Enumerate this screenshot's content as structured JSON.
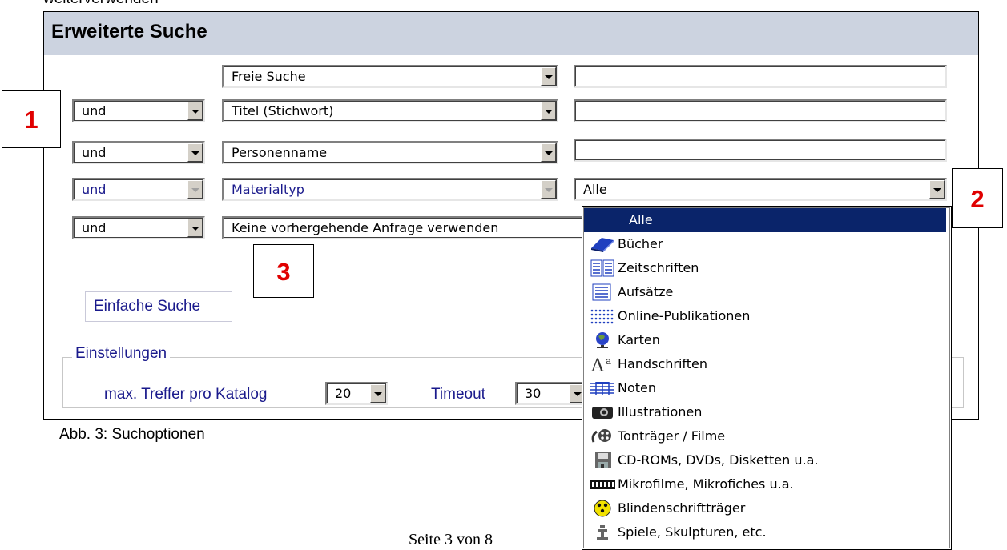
{
  "top_text": "weiterverwenden",
  "panel": {
    "title": "Erweiterte Suche",
    "rows": [
      {
        "operator": "",
        "field": "Freie Suche",
        "value": ""
      },
      {
        "operator": "und",
        "field": "Titel (Stichwort)",
        "value": ""
      },
      {
        "operator": "und",
        "field": "Personenname",
        "value": ""
      },
      {
        "operator": "und",
        "field": "Materialtyp",
        "value": "Alle"
      },
      {
        "operator": "und",
        "field": "Keine vorhergehende Anfrage verwenden",
        "value": ""
      }
    ],
    "simple_search_label": "Einfache Suche",
    "settings": {
      "legend": "Einstellungen",
      "max_hits_label": "max. Treffer pro Katalog",
      "max_hits_value": "20",
      "timeout_label": "Timeout",
      "timeout_value": "30"
    }
  },
  "callouts": {
    "c1": "1",
    "c2": "2",
    "c3": "3"
  },
  "caption": "Abb. 3: Suchoptionen",
  "footer_text": "Seite 3 von 8",
  "dropdown": {
    "items": [
      {
        "label": "Alle",
        "icon": "none",
        "selected": true
      },
      {
        "label": "Bücher",
        "icon": "book-icon"
      },
      {
        "label": "Zeitschriften",
        "icon": "journal-icon"
      },
      {
        "label": "Aufsätze",
        "icon": "article-icon"
      },
      {
        "label": "Online-Publikationen",
        "icon": "online-publication-icon"
      },
      {
        "label": "Karten",
        "icon": "globe-icon"
      },
      {
        "label": "Handschriften",
        "icon": "manuscript-icon"
      },
      {
        "label": "Noten",
        "icon": "sheet-music-icon"
      },
      {
        "label": "Illustrationen",
        "icon": "camera-icon"
      },
      {
        "label": "Tonträger / Filme",
        "icon": "film-reel-icon"
      },
      {
        "label": "CD-ROMs, DVDs, Disketten u.a.",
        "icon": "floppy-disk-icon"
      },
      {
        "label": "Mikrofilme, Mikrofiches u.a.",
        "icon": "microfilm-icon"
      },
      {
        "label": "Blindenschriftträger",
        "icon": "braille-icon"
      },
      {
        "label": "Spiele, Skulpturen, etc.",
        "icon": "game-piece-icon"
      }
    ]
  }
}
